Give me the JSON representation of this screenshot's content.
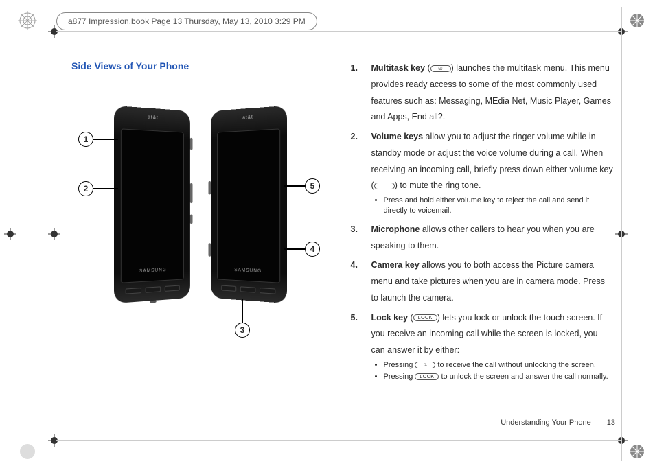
{
  "header_tag": "a877 Impression.book  Page 13  Thursday, May 13, 2010  3:29 PM",
  "section_heading": "Side Views of Your Phone",
  "phone_carrier": "at&t",
  "phone_brand": "SAMSUNG",
  "callouts": {
    "c1": "1",
    "c2": "2",
    "c3": "3",
    "c4": "4",
    "c5": "5"
  },
  "list": [
    {
      "num": "1.",
      "title": "Multitask key",
      "body_a": " (",
      "glyph": "⎚",
      "body_b": ") launches the multitask menu. This menu provides ready access to some of the most commonly used features such as: Messaging, MEdia Net, Music Player, Games and Apps, End all?."
    },
    {
      "num": "2.",
      "title": "Volume keys",
      "body_a": " allow you to adjust the ringer volume while in standby mode or adjust the voice volume during a call. When receiving an incoming call, briefly press down either volume key (",
      "glyph": " ",
      "body_b": ") to mute the ring tone.",
      "sub": [
        "Press and hold either volume key to reject the call and send it directly to voicemail."
      ]
    },
    {
      "num": "3.",
      "title": "Microphone",
      "body_a": " allows other callers to hear you when you are speaking to them."
    },
    {
      "num": "4.",
      "title": "Camera key",
      "body_a": " allows you to both access the Picture camera menu and take pictures when you are in camera mode. Press to launch the camera."
    },
    {
      "num": "5.",
      "title": "Lock key",
      "body_a": " (",
      "glyph": "LOCK",
      "body_b": ") lets you lock or unlock the touch screen. If you receive an incoming call while the screen is locked, you can answer it by either:",
      "sub2": [
        {
          "pre": "Pressing ",
          "glyph": "↴",
          "post": " to receive the call without unlocking the screen."
        },
        {
          "pre": "Pressing ",
          "glyph": "LOCK",
          "post": " to unlock the screen and answer the call normally."
        }
      ]
    }
  ],
  "footer_section": "Understanding Your Phone",
  "footer_page": "13"
}
